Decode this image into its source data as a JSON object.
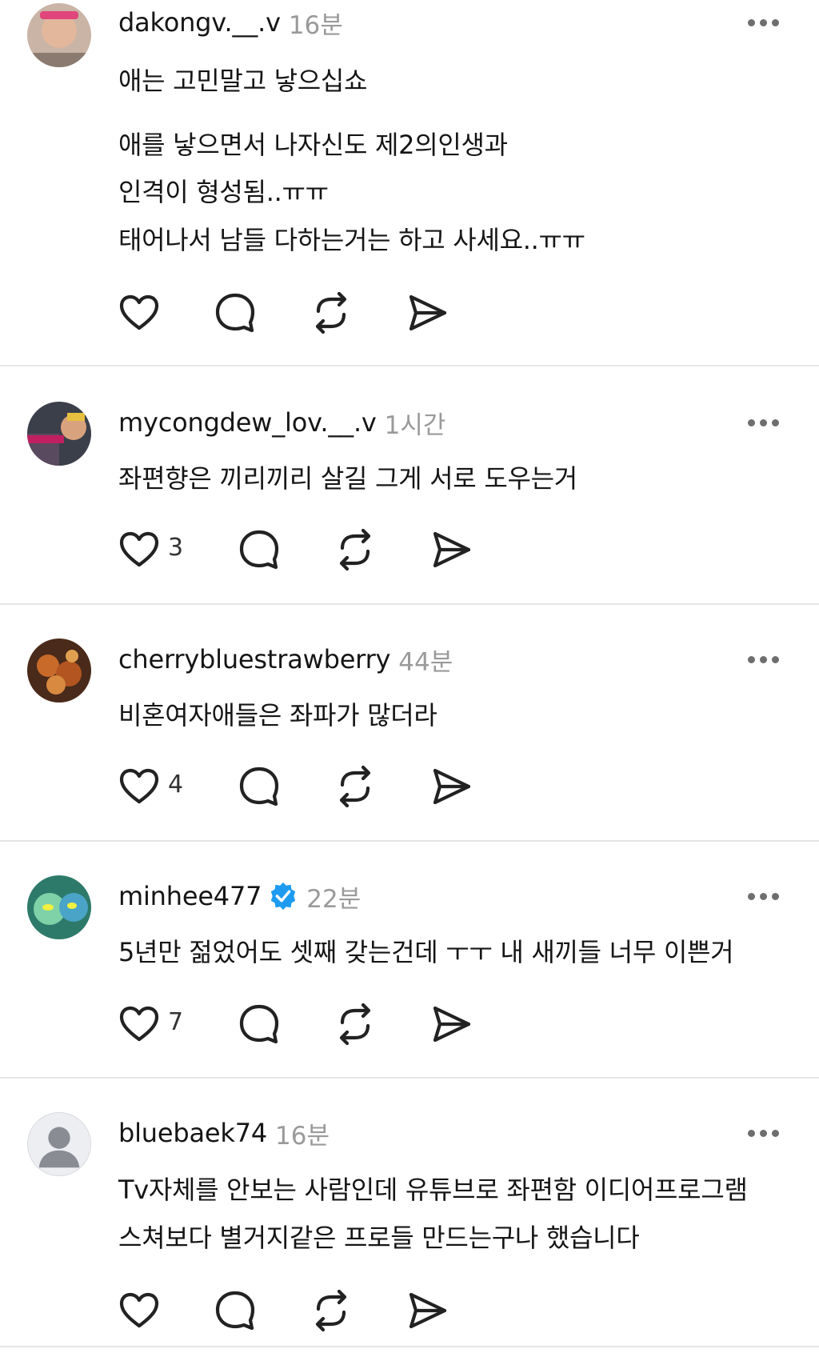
{
  "posts": [
    {
      "username": "dakongv.__.v",
      "time": "16분",
      "verified": false,
      "lines": [
        "애는 고민말고 낳으십쇼",
        "",
        "애를 낳으면서 나자신도 제2의인생과",
        "인격이 형성됨..ㅠㅠ",
        "태어나서 남들 다하는거는 하고 사세요..ㅠㅠ"
      ],
      "likes": ""
    },
    {
      "username": "mycongdew_lov.__.v",
      "time": "1시간",
      "verified": false,
      "lines": [
        "좌편향은 끼리끼리 살길 그게 서로 도우는거"
      ],
      "likes": "3"
    },
    {
      "username": "cherrybluestrawberry",
      "time": "44분",
      "verified": false,
      "lines": [
        "비혼여자애들은 좌파가 많더라"
      ],
      "likes": "4"
    },
    {
      "username": "minhee477",
      "time": "22분",
      "verified": true,
      "lines": [
        "5년만 젊었어도 셋째 갖는건데 ㅜㅜ 내 새끼들 너무 이쁜거"
      ],
      "likes": "7"
    },
    {
      "username": "bluebaek74",
      "time": "16분",
      "verified": false,
      "lines": [
        "Tv자체를 안보는 사람인데 유튜브로 좌편함 이디어프로그램",
        "스쳐보다 별거지같은 프로들 만드는구나 했습니다"
      ],
      "likes": ""
    }
  ],
  "icons": {
    "like": "heart-icon",
    "reply": "comment-bubble-icon",
    "repost": "repost-icon",
    "share": "send-icon",
    "more": "more-dots-icon",
    "verified": "verified-badge-icon"
  },
  "colors": {
    "text": "#151515",
    "muted": "#9a9a9a",
    "divider": "#e6e6e6",
    "verified": "#1d9bf0"
  }
}
